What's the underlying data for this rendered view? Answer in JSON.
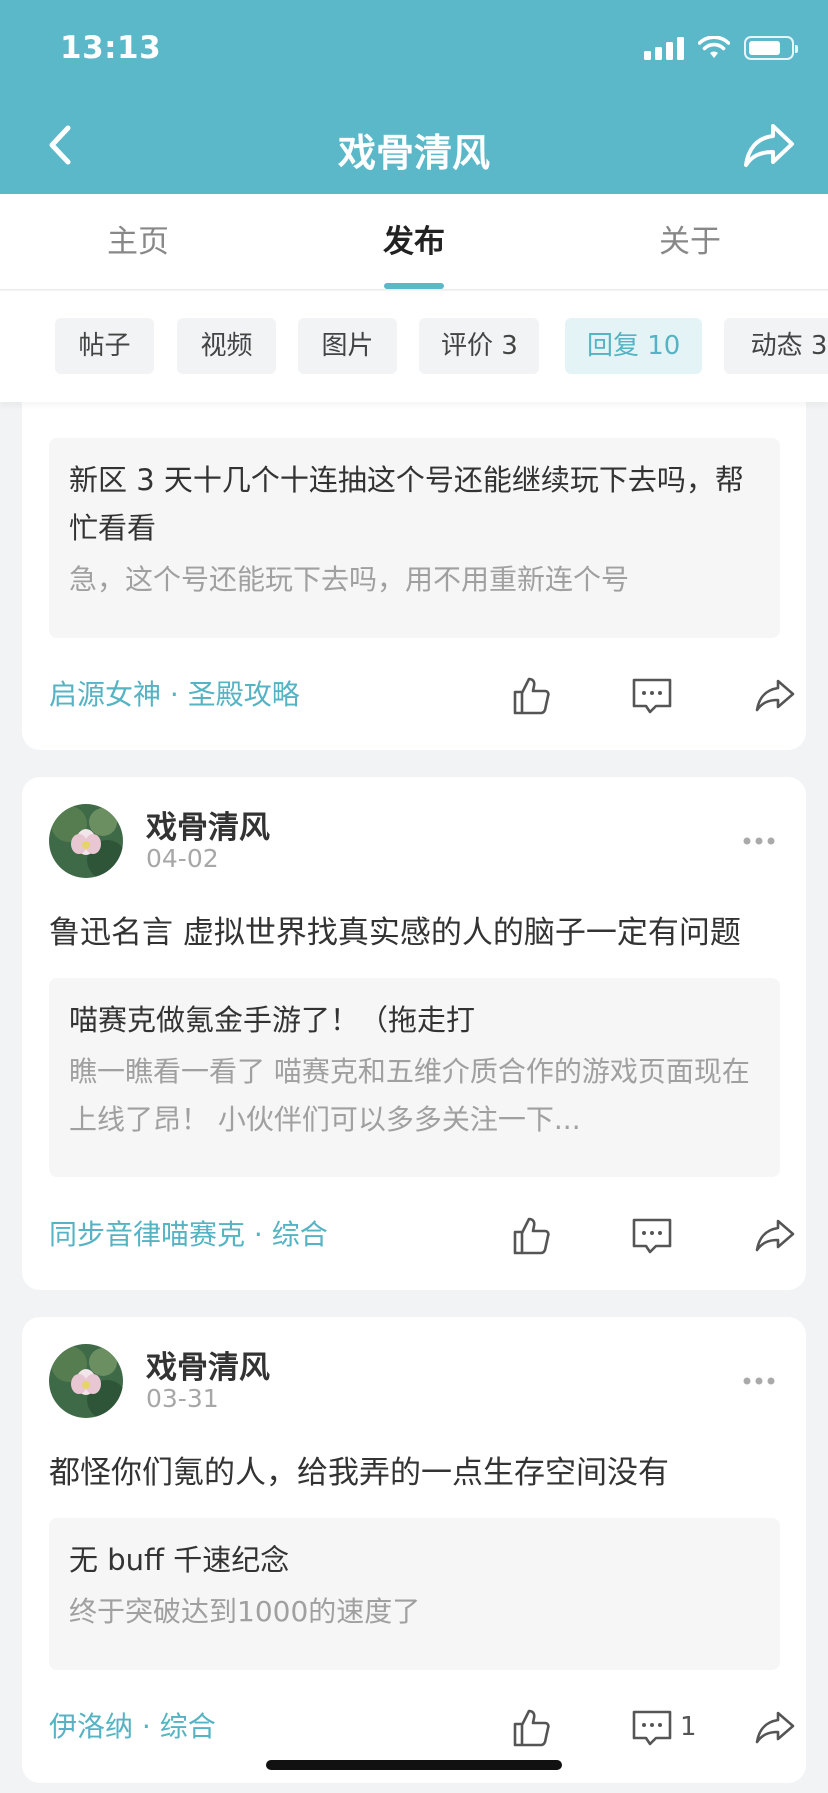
{
  "status_bar": {
    "time": "13:13"
  },
  "nav": {
    "title": "戏骨清风"
  },
  "main_tabs": [
    {
      "label": "主页",
      "active": false
    },
    {
      "label": "发布",
      "active": true
    },
    {
      "label": "关于",
      "active": false
    }
  ],
  "filters": [
    {
      "label": "帖子"
    },
    {
      "label": "视频"
    },
    {
      "label": "图片"
    },
    {
      "label": "评价 3"
    },
    {
      "label": "回复 10",
      "active": true
    },
    {
      "label": "动态 3"
    }
  ],
  "posts": [
    {
      "quote_title": "新区 3 天十几个十连抽这个号还能继续玩下去吗，帮忙看看",
      "quote_desc": "急，这个号还能玩下去吗，用不用重新连个号",
      "source": "启源女神 · 圣殿攻略",
      "comment_count": ""
    },
    {
      "author": "戏骨清风",
      "date": "04-02",
      "text": "鲁迅名言 虚拟世界找真实感的人的脑子一定有问题",
      "quote_title": "喵赛克做氪金手游了！（拖走打",
      "quote_desc": "瞧一瞧看一看了 喵赛克和五维介质合作的游戏页面现在上线了昂！ 小伙伴们可以多多关注一下...",
      "source": "同步音律喵赛克 · 综合",
      "comment_count": ""
    },
    {
      "author": "戏骨清风",
      "date": "03-31",
      "text": "都怪你们氪的人，给我弄的一点生存空间没有",
      "quote_title": "无 buff 千速纪念",
      "quote_desc": "终于突破达到1000的速度了",
      "source": "伊洛纳 · 综合",
      "comment_count": "1"
    }
  ],
  "colors": {
    "accent": "#5bb8c8",
    "link": "#55b3c3"
  },
  "icons": [
    "back-arrow-icon",
    "share-icon",
    "like-icon",
    "comment-icon",
    "more-icon"
  ]
}
